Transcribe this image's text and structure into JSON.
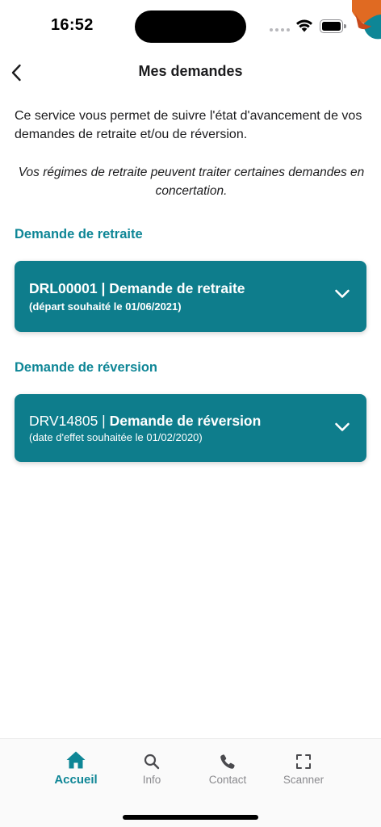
{
  "status_bar": {
    "time": "16:52"
  },
  "header": {
    "title": "Mes demandes"
  },
  "intro_text": "Ce service vous permet de suivre l'état d'avancement de vos demandes de retraite et/ou de réversion.",
  "note_text": "Vos régimes de retraite peuvent traiter certaines demandes en concertation.",
  "sections": {
    "retraite": {
      "title": "Demande de retraite",
      "card": {
        "code": "DRL00001 |",
        "label": "Demande de retraite",
        "subtitle": "(départ souhaité le 01/06/2021)"
      }
    },
    "reversion": {
      "title": "Demande de réversion",
      "card": {
        "code": "DRV14805 |",
        "label": "Demande de réversion",
        "subtitle": "(date d'effet souhaitée le 01/02/2020)"
      }
    }
  },
  "tab_bar": {
    "tabs": [
      {
        "label": "Accueil",
        "icon": "home-icon",
        "active": true
      },
      {
        "label": "Info",
        "icon": "search-icon",
        "active": false
      },
      {
        "label": "Contact",
        "icon": "phone-icon",
        "active": false
      },
      {
        "label": "Scanner",
        "icon": "scan-icon",
        "active": false
      }
    ]
  },
  "colors": {
    "accent": "#0e8696",
    "card": "#0e7d8c",
    "inactive_tab": "#8a8a8e"
  }
}
